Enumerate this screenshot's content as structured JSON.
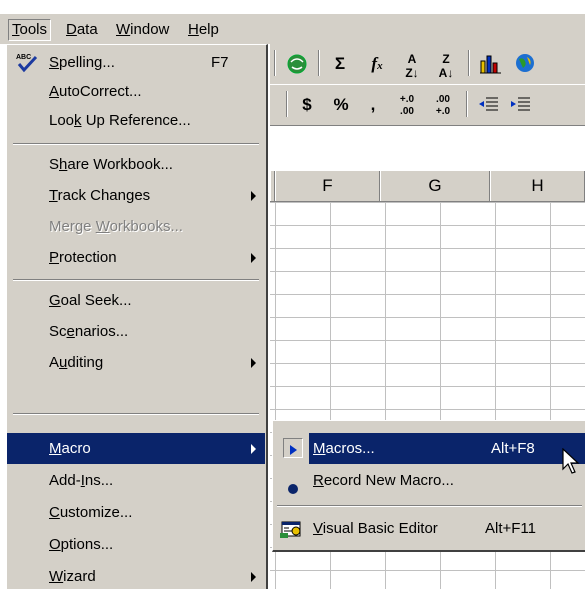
{
  "menubar": {
    "items": [
      "Tools",
      "Data",
      "Window",
      "Help"
    ],
    "accels": [
      "T",
      "D",
      "W",
      "H"
    ]
  },
  "toolbar": {
    "row1": [
      "Σ",
      "fx",
      "A↓Z",
      "Z↓A"
    ],
    "row2": [
      "$",
      "%",
      ",",
      "+.0 .00",
      ".00 +.0"
    ]
  },
  "sheet": {
    "columns": [
      "F",
      "G",
      "H"
    ]
  },
  "tools_menu": {
    "items": [
      {
        "pre": "",
        "u": "S",
        "post": "pelling...",
        "shortcut": "F7",
        "icon": "spelling-abc-check-icon"
      },
      {
        "pre": "",
        "u": "A",
        "post": "utoCorrect...",
        "shortcut": ""
      },
      {
        "pre": "Loo",
        "u": "k",
        "post": " Up Reference...",
        "shortcut": ""
      },
      {
        "pre": "S",
        "u": "h",
        "post": "are Workbook...",
        "shortcut": ""
      },
      {
        "pre": "",
        "u": "T",
        "post": "rack Changes",
        "shortcut": "",
        "submenu": true
      },
      {
        "pre": "Merge ",
        "u": "W",
        "post": "orkbooks...",
        "shortcut": "",
        "disabled": true
      },
      {
        "pre": "",
        "u": "P",
        "post": "rotection",
        "shortcut": "",
        "submenu": true
      },
      {
        "pre": "",
        "u": "G",
        "post": "oal Seek...",
        "shortcut": ""
      },
      {
        "pre": "Sc",
        "u": "e",
        "post": "narios...",
        "shortcut": ""
      },
      {
        "pre": "A",
        "u": "u",
        "post": "diting",
        "shortcut": "",
        "submenu": true
      },
      {
        "pre": "",
        "u": "M",
        "post": "acro",
        "shortcut": "",
        "submenu": true,
        "highlighted": true
      },
      {
        "pre": "Add-",
        "u": "I",
        "post": "ns...",
        "shortcut": ""
      },
      {
        "pre": "",
        "u": "C",
        "post": "ustomize...",
        "shortcut": ""
      },
      {
        "pre": "",
        "u": "O",
        "post": "ptions...",
        "shortcut": ""
      },
      {
        "pre": "",
        "u": "W",
        "post": "izard",
        "shortcut": "",
        "submenu": true
      }
    ]
  },
  "macro_submenu": {
    "items": [
      {
        "pre": "",
        "u": "M",
        "post": "acros...",
        "shortcut": "Alt+F8",
        "icon": "play-macro-icon",
        "highlighted": true
      },
      {
        "pre": "",
        "u": "R",
        "post": "ecord New Macro...",
        "shortcut": "",
        "icon": "record-dot-icon"
      },
      {
        "pre": "",
        "u": "V",
        "post": "isual Basic Editor",
        "shortcut": "Alt+F11",
        "icon": "vb-editor-icon"
      }
    ]
  },
  "colors": {
    "menu_bg": "#d4d0c8",
    "highlight": "#0a246a",
    "disabled_text": "#808080"
  }
}
